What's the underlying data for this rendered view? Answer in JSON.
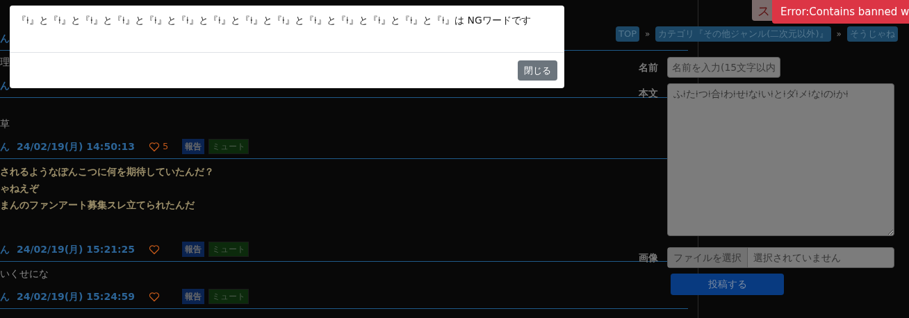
{
  "posts": [
    {
      "author": "ん"
    },
    {
      "lines": [
        "理"
      ],
      "author": "ん"
    },
    {
      "lines": [
        "草"
      ],
      "author": "ん",
      "date": "24/02/19(月) 14:50:13",
      "likes": "5",
      "report": "報告",
      "mute": "ミュート"
    },
    {
      "lines": [
        "されるようなぽんこつに何を期待していたんだ？",
        "ゃねえぞ",
        "まんのファンアート募集スレ立てられたんだ"
      ],
      "bold": true,
      "author": "ん",
      "date": "24/02/19(月) 15:21:25",
      "report": "報告",
      "mute": "ミュート"
    },
    {
      "lines": [
        "いくせにな"
      ],
      "author": "ん",
      "date": "24/02/19(月) 15:24:59",
      "report": "報告",
      "mute": "ミュート"
    }
  ],
  "breadcrumb": [
    "TOP",
    "»",
    "カテゴリ『その他ジャンル(二次元以外)』",
    "»",
    "そうじゃね"
  ],
  "form": {
    "name_label": "名前",
    "name_placeholder": "名前を入力(15文字以内",
    "body_label": "本文",
    "body_value": "ふ⍿た⍿つ⍿合⍿わ⍿せ⍿な⍿い⍿と⍿ダ⍿メ⍿な⍿の⍿か⍿",
    "image_label": "画像",
    "file_button": "ファイルを選択",
    "file_status": "選択されていません",
    "submit": "投稿する"
  },
  "top_button": "ス",
  "toast": "Error:Contains banned w",
  "modal": {
    "message": "『⍿』と『⍿』と『⍿』と『⍿』と『⍿』と『⍿』と『⍿』と『⍿』と『⍿』と『⍿』と『⍿』と『⍿』と『⍿』と『⍿』は NGワードです",
    "close": "閉じる"
  }
}
